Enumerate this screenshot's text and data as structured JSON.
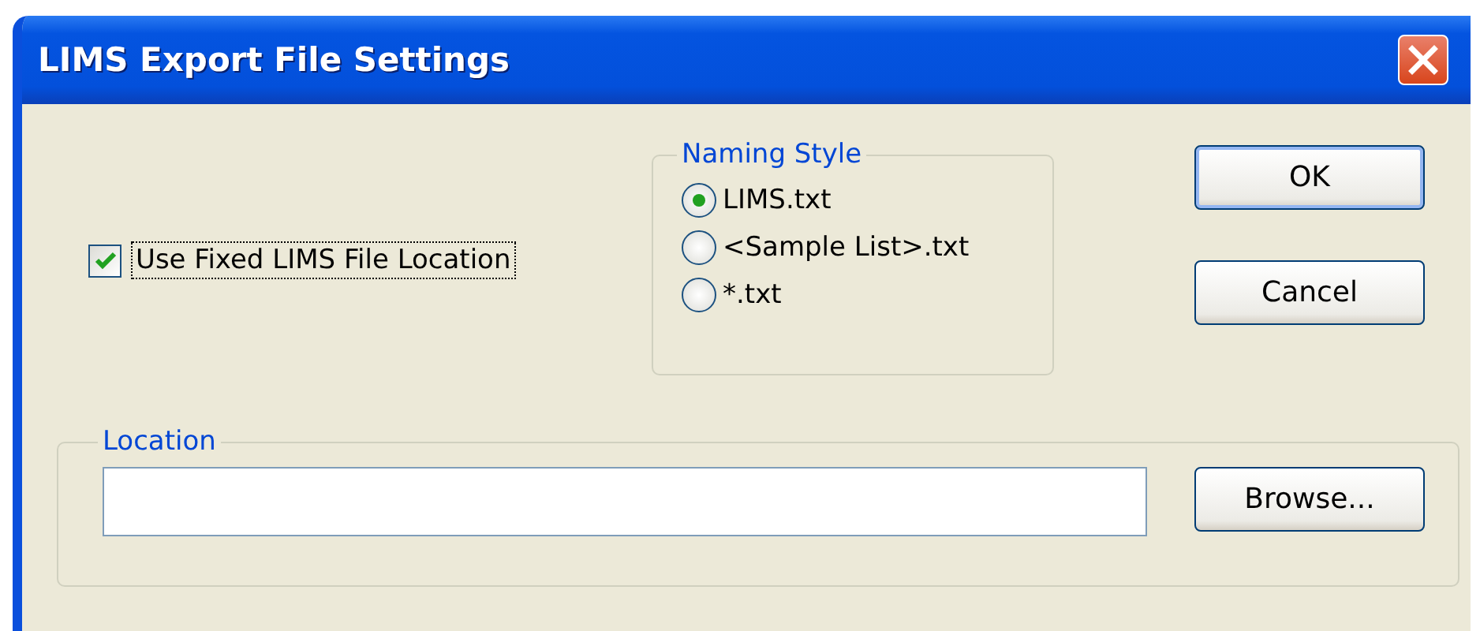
{
  "window": {
    "title": "LIMS Export File Settings"
  },
  "use_fixed_location": {
    "label": "Use Fixed LIMS File Location",
    "checked": true,
    "focused": true
  },
  "naming_style": {
    "legend": "Naming Style",
    "options": [
      {
        "label": "LIMS.txt",
        "selected": true
      },
      {
        "label": "<Sample List>.txt",
        "selected": false
      },
      {
        "label": "*.txt",
        "selected": false
      }
    ]
  },
  "buttons": [
    "OK",
    "Cancel"
  ],
  "location": {
    "legend": "Location",
    "browse": "Browse..."
  }
}
